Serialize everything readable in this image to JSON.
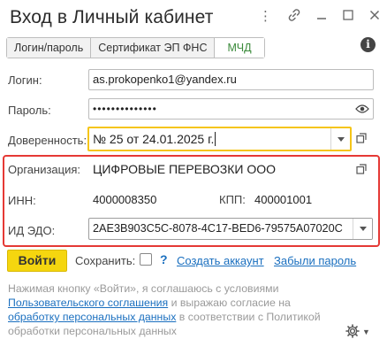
{
  "window": {
    "title": "Вход в Личный кабинет",
    "icons": [
      "more-vert-icon",
      "link-icon",
      "minimize-icon",
      "maximize-icon",
      "close-icon"
    ]
  },
  "tabs": [
    {
      "label": "Логин/пароль",
      "active": false
    },
    {
      "label": "Сертификат ЭП ФНС",
      "active": false
    },
    {
      "label": "МЧД",
      "active": true
    }
  ],
  "form": {
    "login_label": "Логин:",
    "login_value": "as.prokopenko1@yandex.ru",
    "password_label": "Пароль:",
    "password_value": "••••••••••••••",
    "trust_label": "Доверенность:",
    "trust_value": "№ 25 от 24.01.2025 г.",
    "org_label": "Организация:",
    "org_value": "ЦИФРОВЫЕ ПЕРЕВОЗКИ ООО",
    "inn_label": "ИНН:",
    "inn_value": "4000008350",
    "kpp_label": "КПП:",
    "kpp_value": "400001001",
    "edo_label": "ИД ЭДО:",
    "edo_value": "2AE3B903C5C-8078-4C17-BED6-79575A07020C"
  },
  "actions": {
    "login_button": "Войти",
    "save_label": "Сохранить:",
    "help": "?",
    "create_account": "Создать аккаунт",
    "forgot_password": "Забыли пароль"
  },
  "notice": {
    "text1": "Нажимая кнопку «Войти», я соглашаюсь с условиями",
    "link1": "Пользовательского соглашения",
    "text2": " и выражаю согласие на",
    "link2": "обработку персональных данных",
    "text3": " в соответствии с Политикой обработки персональных данных"
  },
  "colors": {
    "accent_yellow": "#f5d60f",
    "highlight_red": "#e53935",
    "link_blue": "#1a6fbf",
    "active_tab_green": "#3a8a3a"
  }
}
